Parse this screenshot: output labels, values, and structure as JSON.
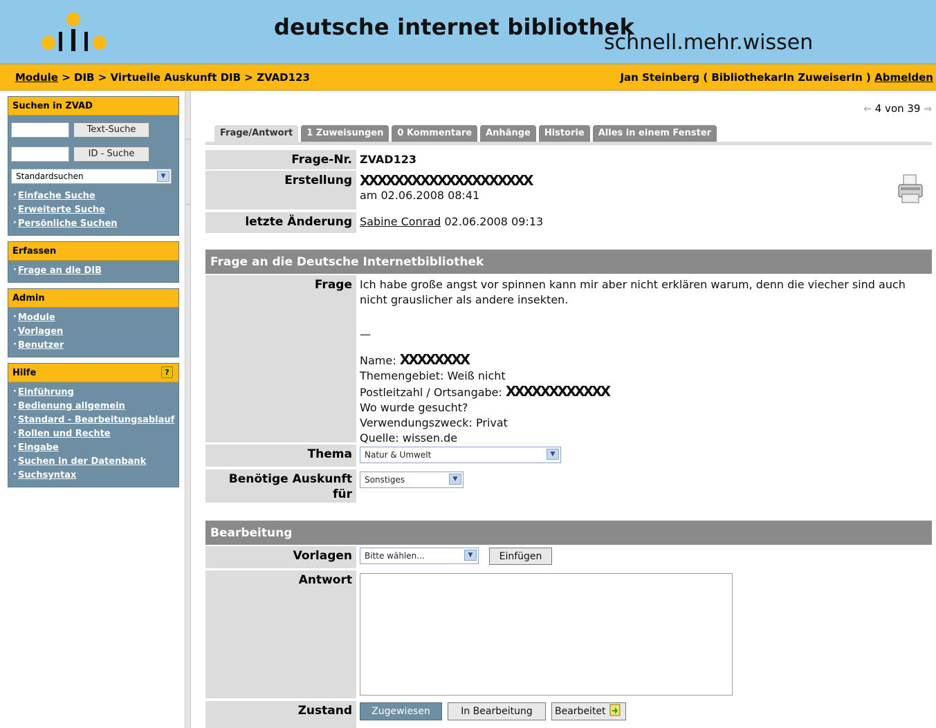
{
  "header": {
    "title": "deutsche internet bibliothek",
    "tagline": "schnell.mehr.wissen"
  },
  "breadcrumb": {
    "items": [
      "Module",
      "DIB",
      "Virtuelle Auskunft DIB",
      "ZVAD123"
    ],
    "separator": ">",
    "user_name": "Jan Steinberg",
    "user_role": "( BibliothekarIn ZuweiserIn )",
    "logout": "Abmelden"
  },
  "sidebar": {
    "search": {
      "title": "Suchen in ZVAD",
      "text_search_button": "Text-Suche",
      "id_search_button": "ID - Suche",
      "select_value": "Standardsuchen",
      "links": [
        "Einfache Suche",
        "Erweiterte Suche",
        "Persönliche Suchen"
      ]
    },
    "capture": {
      "title": "Erfassen",
      "links": [
        "Frage an die DIB"
      ]
    },
    "admin": {
      "title": "Admin",
      "links": [
        "Module",
        "Vorlagen",
        "Benutzer"
      ]
    },
    "help": {
      "title": "Hilfe",
      "icon": "?",
      "links": [
        "Einführung",
        "Bedienung allgemein",
        "Standard - Bearbeitungsablauf",
        "Rollen und Rechte",
        "Eingabe",
        "Suchen in der Datenbank",
        "Suchsyntax"
      ]
    }
  },
  "pager": {
    "text": "4 von 39"
  },
  "tabs": [
    "Frage/Antwort",
    "1 Zuweisungen",
    "0 Kommentare",
    "Anhänge",
    "Historie",
    "Alles in einem Fenster"
  ],
  "meta": {
    "question_no_label": "Frage-Nr.",
    "question_no": "ZVAD123",
    "created_label": "Erstellung",
    "created_redacted": "XXXXXXXXXXXXXXXXXXXX",
    "created_date": "am 02.06.2008 08:41",
    "modified_label": "letzte Änderung",
    "modified_by": "Sabine Conrad",
    "modified_date": "02.06.2008 09:13"
  },
  "question_section": {
    "title": "Frage an die Deutsche Internetbibliothek",
    "question_label": "Frage",
    "question_text": "Ich habe große angst vor spinnen kann mir aber nicht erklären warum, denn die viecher sind auch nicht grauslicher als andere insekten.",
    "separator": "—",
    "name_label": "Name:",
    "name_redacted": "XXXXXXXX",
    "topic_line": "Themengebiet: Weiß nicht",
    "zip_label": "Postleitzahl / Ortsangabe:",
    "zip_redacted": "XXXXXXXXXXXX",
    "where_line": "Wo wurde gesucht?",
    "purpose_line": "Verwendungszweck: Privat",
    "source_line": "Quelle: wissen.de",
    "theme_label": "Thema",
    "theme_value": "Natur & Umwelt",
    "need_label": "Benötige Auskunft für",
    "need_value": "Sonstiges"
  },
  "processing_section": {
    "title": "Bearbeitung",
    "templates_label": "Vorlagen",
    "templates_value": "Bitte wählen...",
    "insert_button": "Einfügen",
    "answer_label": "Antwort",
    "answer_value": "",
    "state_label": "Zustand",
    "state_buttons": [
      "Zugewiesen",
      "In Bearbeitung",
      "Bearbeitet"
    ]
  }
}
